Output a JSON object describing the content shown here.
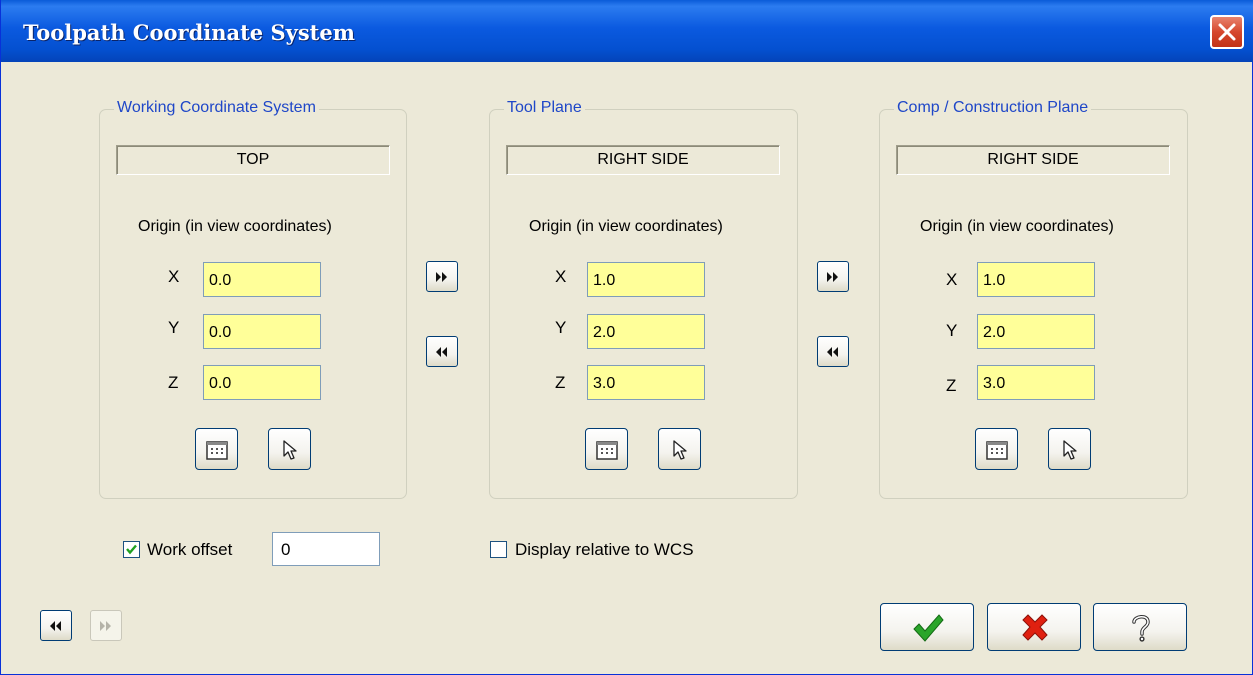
{
  "window": {
    "title": "Toolpath Coordinate System"
  },
  "panels": [
    {
      "legend": "Working Coordinate System",
      "view_name": "TOP",
      "origin_label": "Origin (in view coordinates)",
      "axes": [
        {
          "label": "X",
          "value": "0.0"
        },
        {
          "label": "Y",
          "value": "0.0"
        },
        {
          "label": "Z",
          "value": "0.0"
        }
      ]
    },
    {
      "legend": "Tool Plane",
      "view_name": "RIGHT SIDE",
      "origin_label": "Origin (in view coordinates)",
      "axes": [
        {
          "label": "X",
          "value": "1.0"
        },
        {
          "label": "Y",
          "value": "2.0"
        },
        {
          "label": "Z",
          "value": "3.0"
        }
      ]
    },
    {
      "legend": "Comp / Construction Plane",
      "view_name": "RIGHT SIDE",
      "origin_label": "Origin (in view coordinates)",
      "axes": [
        {
          "label": "X",
          "value": "1.0"
        },
        {
          "label": "Y",
          "value": "2.0"
        },
        {
          "label": "Z",
          "value": "3.0"
        }
      ]
    }
  ],
  "panel_buttons": {
    "left_icon": "calculator-icon",
    "right_icon": "pointer-select-icon"
  },
  "copy_buttons": {
    "forward_icon": "double-right-arrow-icon",
    "backward_icon": "double-left-arrow-icon"
  },
  "work_offset": {
    "label": "Work offset",
    "checked": true,
    "value": "0"
  },
  "display_relative": {
    "label": "Display relative to WCS",
    "checked": false
  },
  "nav": {
    "prev_enabled": true,
    "next_enabled": false
  },
  "actions": {
    "ok_icon": "checkmark-icon",
    "cancel_icon": "red-x-icon",
    "help_icon": "question-mark-icon"
  },
  "colors": {
    "title_bar": "#0a5bd8",
    "group_legend": "#1f47c8",
    "field_bg": "#ffff99",
    "dialog_bg": "#ece9d8",
    "ok_green": "#2aa52a",
    "cancel_red": "#e02010"
  }
}
